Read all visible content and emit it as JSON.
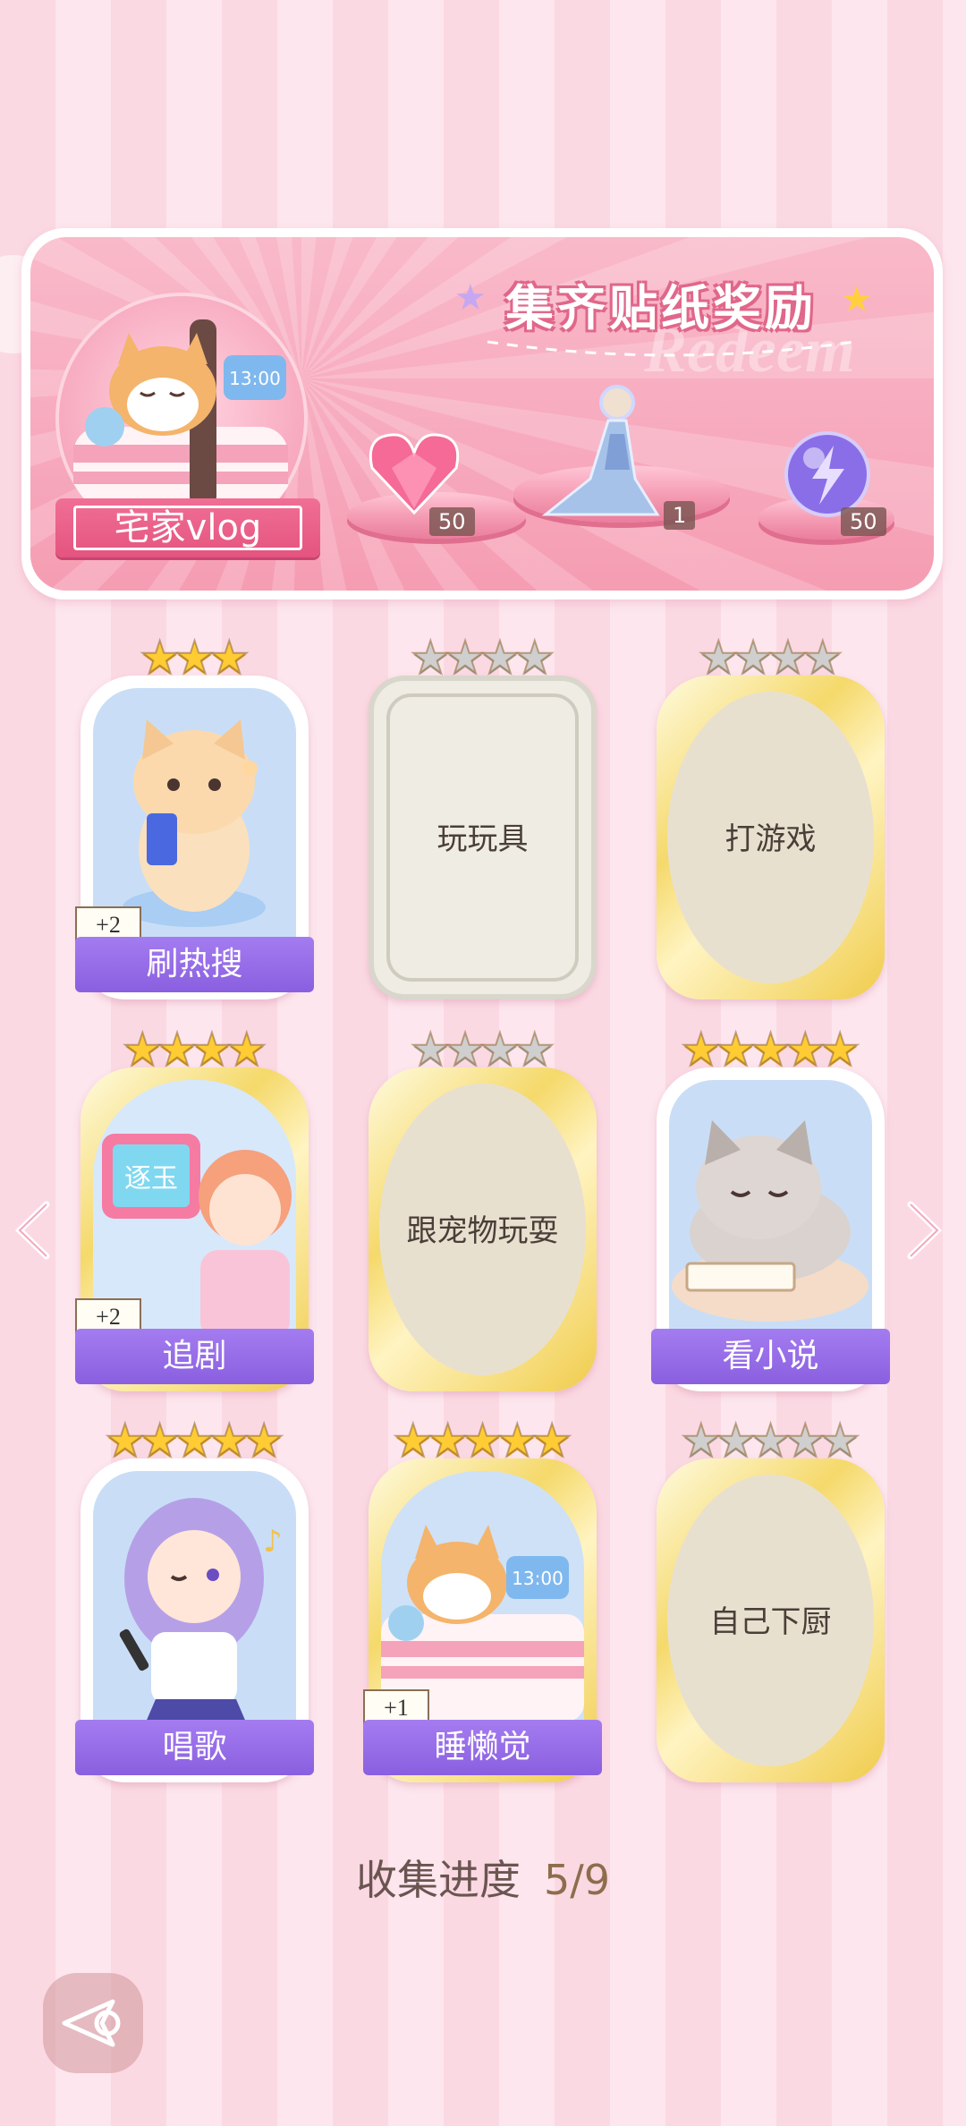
{
  "banner": {
    "title": "集齐贴纸奖励",
    "watermark": "Redeem",
    "vlog_label": "宅家vlog",
    "rewards": [
      {
        "icon": "heart-gem-icon",
        "count": "50"
      },
      {
        "icon": "outfit-figure-icon",
        "count": "1"
      },
      {
        "icon": "lightning-orb-icon",
        "count": "50"
      }
    ],
    "clock_text": "13:00"
  },
  "cards": [
    {
      "label": "刷热搜",
      "stars_on": 3,
      "stars_total": 3,
      "unlocked": true,
      "plus": "+2",
      "art": "cat-phone-illustration"
    },
    {
      "label": "玩玩具",
      "stars_on": 0,
      "stars_total": 4,
      "unlocked": false,
      "frame": "silver"
    },
    {
      "label": "打游戏",
      "stars_on": 0,
      "stars_total": 4,
      "unlocked": false,
      "frame": "gold"
    },
    {
      "label": "追剧",
      "stars_on": 4,
      "stars_total": 4,
      "unlocked": true,
      "plus": "+2",
      "art": "girl-tv-illustration",
      "tv_text": "逐玉"
    },
    {
      "label": "跟宠物玩耍",
      "stars_on": 0,
      "stars_total": 4,
      "unlocked": false,
      "frame": "gold"
    },
    {
      "label": "看小说",
      "stars_on": 5,
      "stars_total": 5,
      "unlocked": true,
      "art": "cat-reading-illustration"
    },
    {
      "label": "唱歌",
      "stars_on": 5,
      "stars_total": 5,
      "unlocked": true,
      "art": "girl-singing-illustration"
    },
    {
      "label": "睡懒觉",
      "stars_on": 5,
      "stars_total": 5,
      "unlocked": true,
      "plus": "+1",
      "art": "dog-sleeping-illustration",
      "clock_text": "13:00"
    },
    {
      "label": "自己下厨",
      "stars_on": 0,
      "stars_total": 5,
      "unlocked": false,
      "frame": "gold"
    }
  ],
  "progress": {
    "label": "收集进度",
    "value": "5/9"
  },
  "nav": {
    "prev_icon": "chevron-left-icon",
    "next_icon": "chevron-right-icon",
    "back_icon": "back-arrow-icon"
  }
}
